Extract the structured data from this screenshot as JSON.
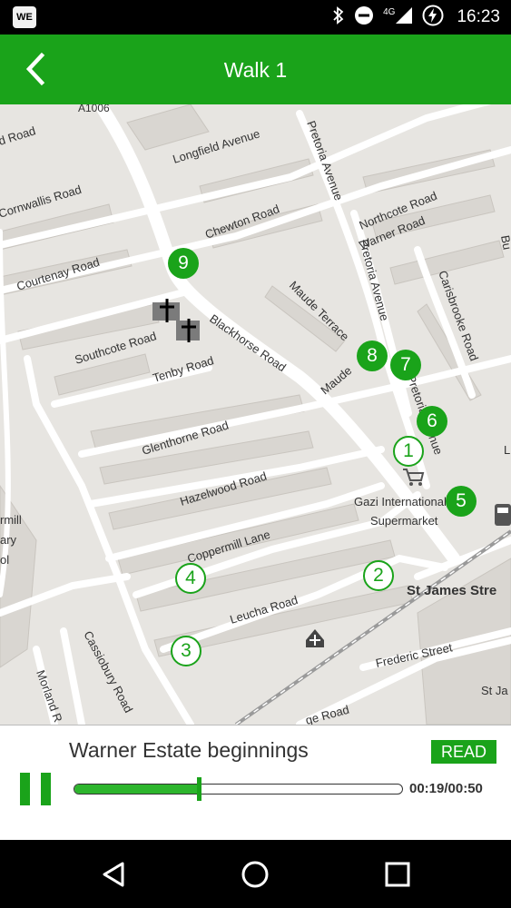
{
  "status_bar": {
    "app_badge": "WE",
    "network": "4G",
    "time": "16:23",
    "icons": [
      "bluetooth-icon",
      "do-not-disturb-icon",
      "cell-signal-icon",
      "battery-saver-icon"
    ]
  },
  "header": {
    "title": "Walk 1",
    "back_icon": "back-arrow-icon",
    "color": "#1aa31a"
  },
  "map": {
    "road_labels": [
      "Warner Road",
      "Longfield Avenue",
      "Cornwallis Road",
      "Chewton Road",
      "Pretoria Avenue",
      "Northcote Road",
      "Courtenay Road",
      "Maude Terrace",
      "Pretoria Avenue",
      "Carisbrooke Road",
      "Southcote Road",
      "Blackhorse Road",
      "Tenby Road",
      "Maude",
      "Pretoria Avenue",
      "Glenthorne Road",
      "Hazelwood Road",
      "Gazi International",
      "Supermarket",
      "Coppermill Lane",
      "St James Stre",
      "Leucha Road",
      "Frederic Street",
      "Cassiobury Road",
      "Morland R",
      "ge Road",
      "St Ja",
      "A1006",
      "rmill",
      "ary",
      "ol",
      "d Road",
      "Bu",
      "L"
    ],
    "markers": [
      {
        "label": "1",
        "style": "outline"
      },
      {
        "label": "2",
        "style": "outline"
      },
      {
        "label": "3",
        "style": "outline"
      },
      {
        "label": "4",
        "style": "outline"
      },
      {
        "label": "5",
        "style": "filled"
      },
      {
        "label": "6",
        "style": "filled"
      },
      {
        "label": "7",
        "style": "filled"
      },
      {
        "label": "8",
        "style": "filled"
      },
      {
        "label": "9",
        "style": "filled"
      }
    ],
    "poi_icons": [
      "church-icon",
      "church-icon",
      "shopping-cart-icon",
      "medical-icon",
      "train-station-icon"
    ]
  },
  "player": {
    "track_title": "Warner Estate beginnings",
    "read_label": "READ",
    "time_readout": "00:19/00:50",
    "progress": 0.38,
    "pause_icon": "pause-icon",
    "accent": "#1aa31a"
  },
  "nav_bar": {
    "icons": [
      "back-triangle-icon",
      "home-circle-icon",
      "recents-square-icon"
    ]
  }
}
